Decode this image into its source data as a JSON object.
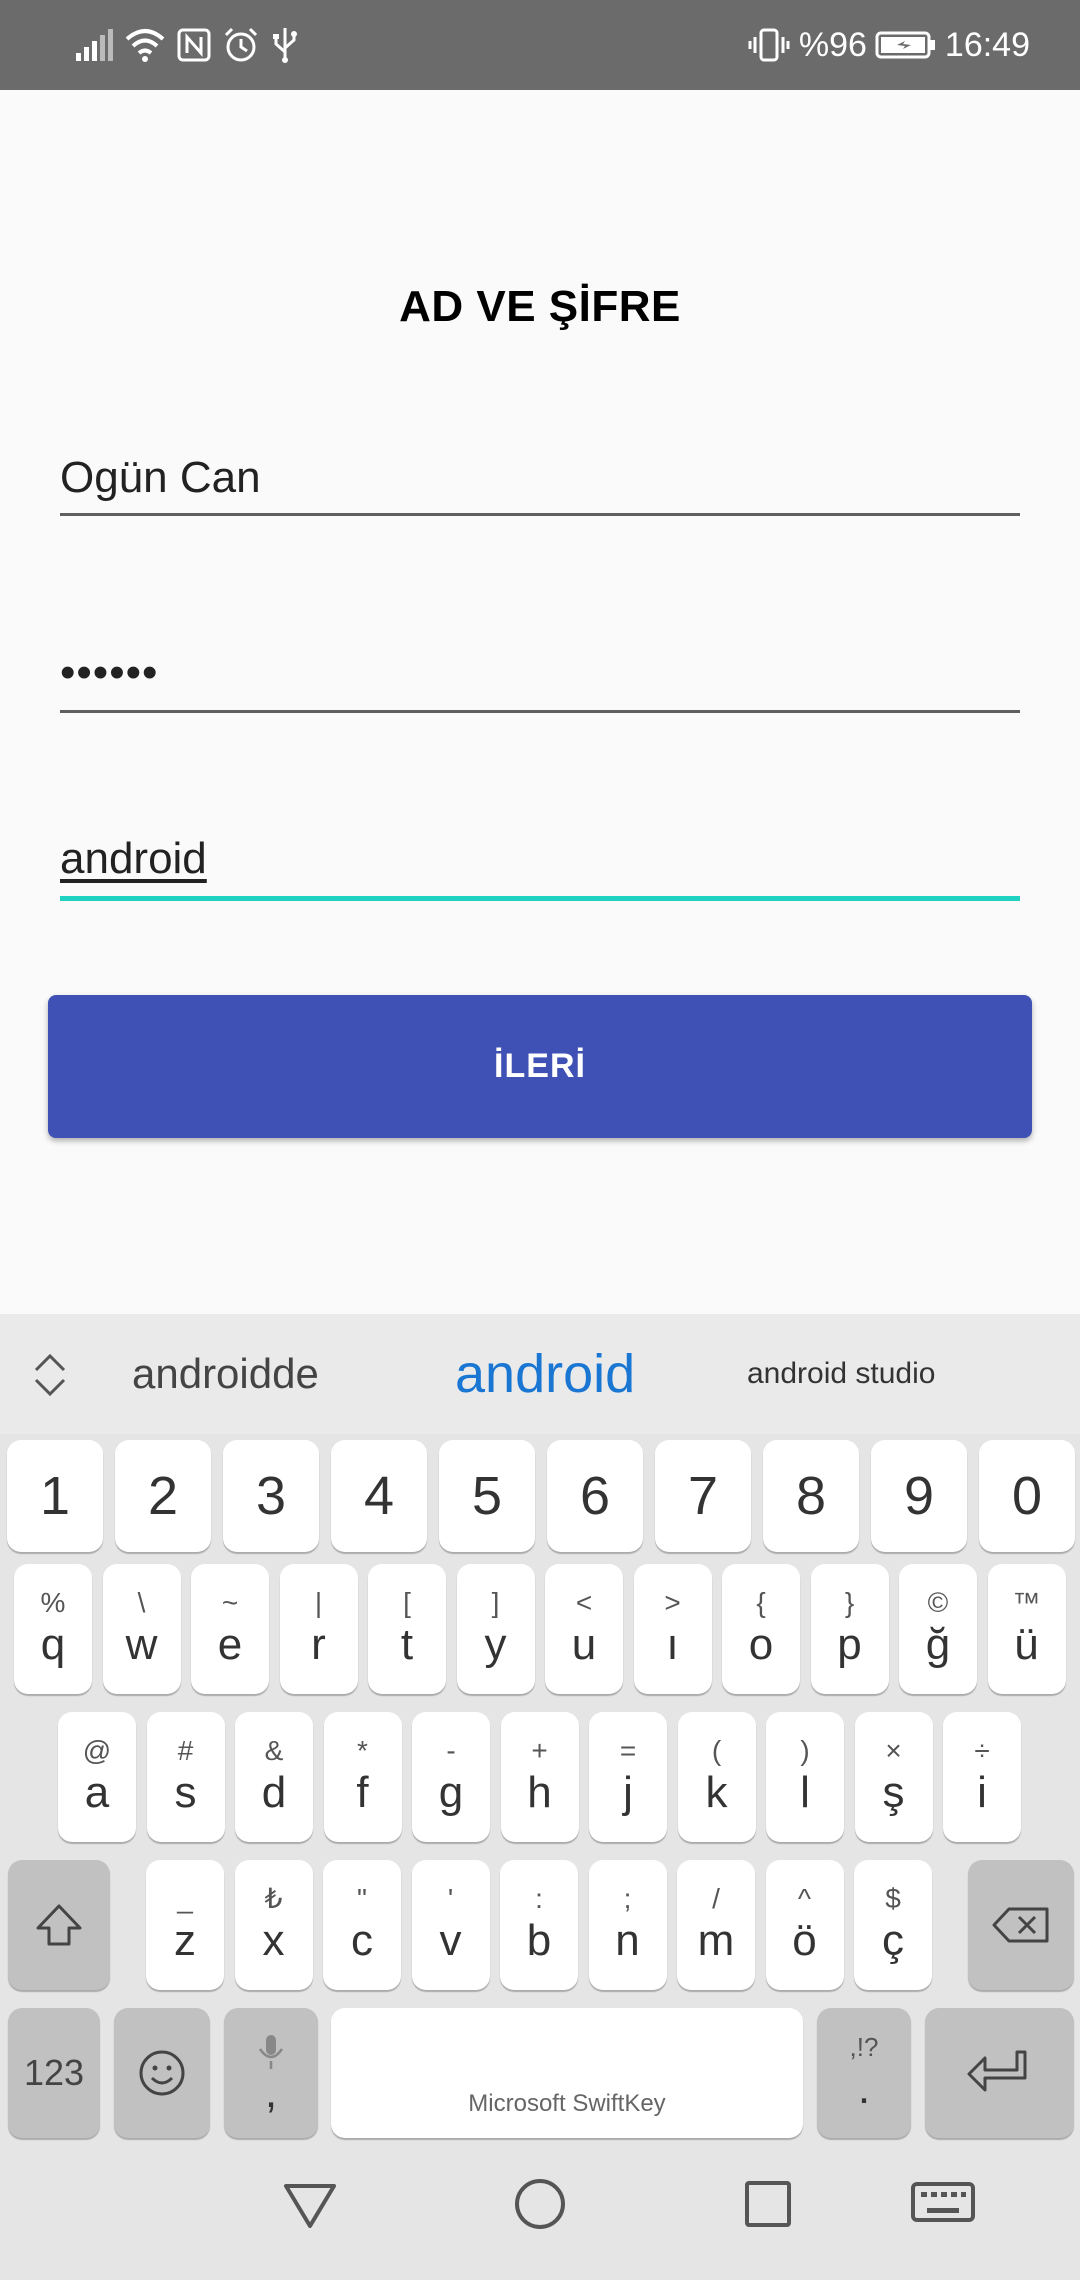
{
  "status_bar": {
    "battery_percent": "%96",
    "time": "16:49",
    "icons": [
      "signal-icon",
      "wifi-icon",
      "nfc-icon",
      "alarm-icon",
      "usb-icon",
      "vibrate-icon",
      "battery-icon"
    ]
  },
  "form": {
    "title": "AD VE ŞİFRE",
    "name_value": "Ogün Can",
    "password_value": "••••••",
    "third_value": "android",
    "submit_label": "İLERİ"
  },
  "keyboard": {
    "suggestions": [
      "androidde",
      "android",
      "android studio"
    ],
    "number_row": [
      "1",
      "2",
      "3",
      "4",
      "5",
      "6",
      "7",
      "8",
      "9",
      "0"
    ],
    "row1": [
      {
        "hint": "%",
        "main": "q"
      },
      {
        "hint": "\\",
        "main": "w"
      },
      {
        "hint": "~",
        "main": "e"
      },
      {
        "hint": "|",
        "main": "r"
      },
      {
        "hint": "[",
        "main": "t"
      },
      {
        "hint": "]",
        "main": "y"
      },
      {
        "hint": "<",
        "main": "u"
      },
      {
        "hint": ">",
        "main": "ı"
      },
      {
        "hint": "{",
        "main": "o"
      },
      {
        "hint": "}",
        "main": "p"
      },
      {
        "hint": "©",
        "main": "ğ"
      },
      {
        "hint": "™",
        "main": "ü"
      }
    ],
    "row2": [
      {
        "hint": "@",
        "main": "a"
      },
      {
        "hint": "#",
        "main": "s"
      },
      {
        "hint": "&",
        "main": "d"
      },
      {
        "hint": "*",
        "main": "f"
      },
      {
        "hint": "-",
        "main": "g"
      },
      {
        "hint": "+",
        "main": "h"
      },
      {
        "hint": "=",
        "main": "j"
      },
      {
        "hint": "(",
        "main": "k"
      },
      {
        "hint": ")",
        "main": "l"
      },
      {
        "hint": "×",
        "main": "ş"
      },
      {
        "hint": "÷",
        "main": "i"
      }
    ],
    "row3": [
      {
        "hint": "_",
        "main": "z"
      },
      {
        "hint": "₺",
        "main": "x"
      },
      {
        "hint": "\"",
        "main": "c"
      },
      {
        "hint": "'",
        "main": "v"
      },
      {
        "hint": ":",
        "main": "b"
      },
      {
        "hint": ";",
        "main": "n"
      },
      {
        "hint": "/",
        "main": "m"
      },
      {
        "hint": "^",
        "main": "ö"
      },
      {
        "hint": "$",
        "main": "ç"
      }
    ],
    "key_123": "123",
    "comma": ",",
    "period": ".",
    "period_hint": ",!?",
    "space_brand": "Microsoft SwiftKey",
    "accent_color": "#1976d2"
  },
  "colors": {
    "button": "#3f51b5",
    "focus_line": "#1fd1c0",
    "status_bar": "#6b6b6b"
  }
}
